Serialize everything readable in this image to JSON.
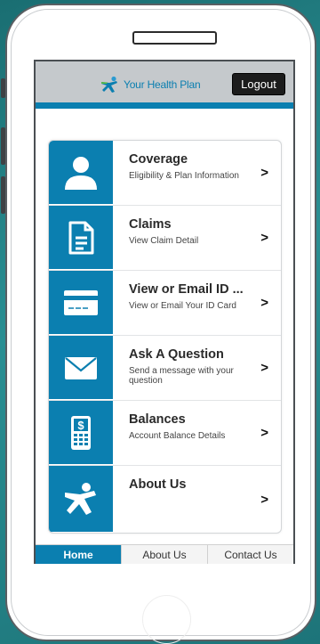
{
  "header": {
    "brand_name": "Your Health Plan",
    "logout_label": "Logout"
  },
  "menu": {
    "items": [
      {
        "title": "Coverage",
        "subtitle": "Eligibility & Plan Information",
        "icon": "person-icon"
      },
      {
        "title": "Claims",
        "subtitle": "View Claim Detail",
        "icon": "document-icon"
      },
      {
        "title": "View or Email ID ...",
        "subtitle": "View or Email Your ID Card",
        "icon": "id-card-icon"
      },
      {
        "title": "Ask A Question",
        "subtitle": "Send a message with your question",
        "icon": "envelope-icon"
      },
      {
        "title": "Balances",
        "subtitle": "Account Balance Details",
        "icon": "calculator-icon"
      },
      {
        "title": "About Us",
        "subtitle": "",
        "icon": "logo-figure-icon"
      }
    ],
    "chevron": ">"
  },
  "tabs": [
    {
      "label": "Home",
      "active": true
    },
    {
      "label": "About Us",
      "active": false
    },
    {
      "label": "Contact Us",
      "active": false
    }
  ],
  "colors": {
    "accent": "#0b7fb0",
    "header_bg": "#c5c9cc",
    "logout_bg": "#1c1c1c"
  }
}
